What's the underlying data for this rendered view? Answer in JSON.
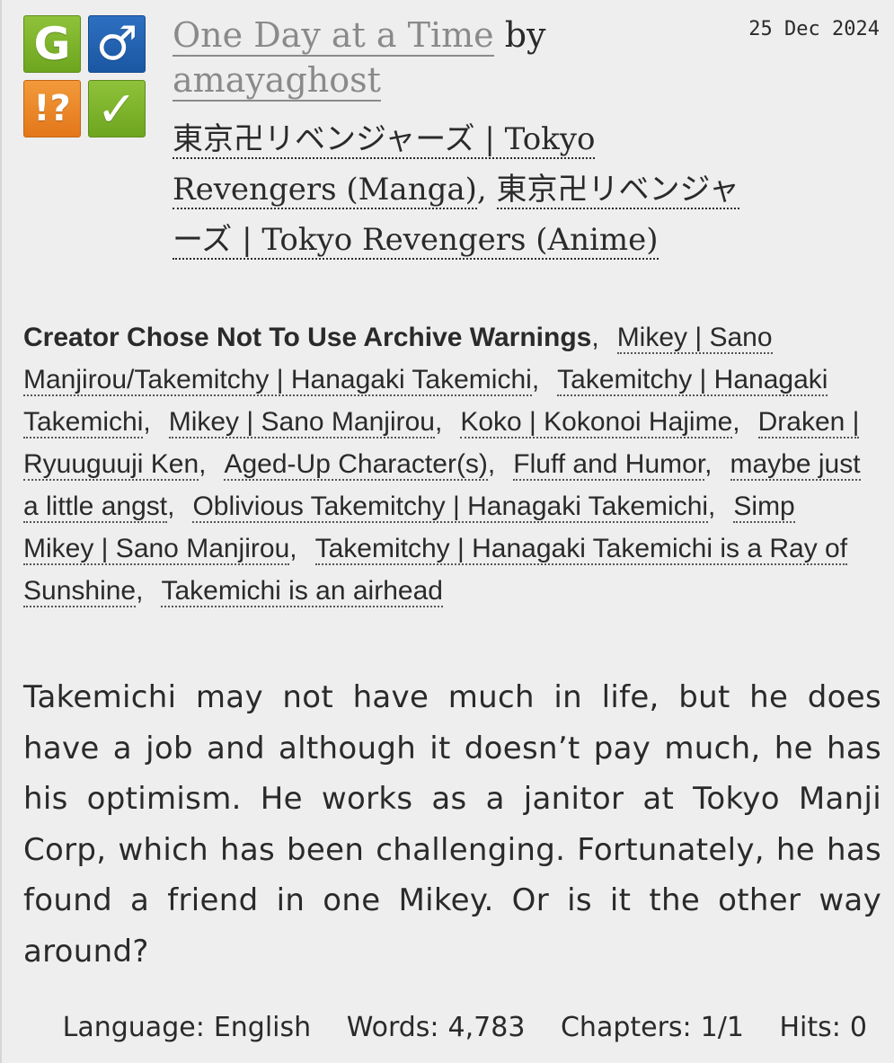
{
  "required_tags": {
    "rating": {
      "glyph": "G",
      "color": "#7cb32a",
      "icon": "rating-general-icon"
    },
    "category": {
      "glyph": "♂",
      "color": "#2463b2",
      "icon": "category-mm-icon"
    },
    "warning": {
      "glyph": "!?",
      "color": "#ec8a2a",
      "icon": "warning-choose-not-icon"
    },
    "complete": {
      "glyph": "✓",
      "color": "#7cb32a",
      "icon": "complete-icon"
    }
  },
  "heading": {
    "title": "One Day at a Time",
    "by": "by",
    "author": "amayaghost"
  },
  "datetime": "25 Dec 2024",
  "fandoms": [
    "東京卍リベンジャーズ | Tokyo Revengers (Manga)",
    "東京卍リベンジャーズ | Tokyo Revengers (Anime)"
  ],
  "tags": {
    "warning": "Creator Chose Not To Use Archive Warnings",
    "items": [
      "Mikey | Sano Manjirou/Takemitchy | Hanagaki Takemichi",
      "Takemitchy | Hanagaki Takemichi",
      "Mikey | Sano Manjirou",
      "Koko | Kokonoi Hajime",
      "Draken | Ryuuguuji Ken",
      "Aged-Up Character(s)",
      "Fluff and Humor",
      "maybe just a little angst",
      "Oblivious Takemitchy | Hanagaki Takemichi",
      "Simp Mikey | Sano Manjirou",
      "Takemitchy | Hanagaki Takemichi is a Ray of Sunshine",
      "Takemichi is an airhead"
    ]
  },
  "summary": "Takemichi may not have much in life, but he does have a job and although it doesn’t pay much, he has his optimism. He works as a janitor at Tokyo Manji Corp, which has been challenging. Fortunately, he has found a friend in one Mikey. Or is it the other way around?",
  "stats": {
    "language_label": "Language:",
    "language": "English",
    "words_label": "Words:",
    "words": "4,783",
    "chapters_label": "Chapters:",
    "chapters": "1/1",
    "hits_label": "Hits:",
    "hits": "0"
  }
}
